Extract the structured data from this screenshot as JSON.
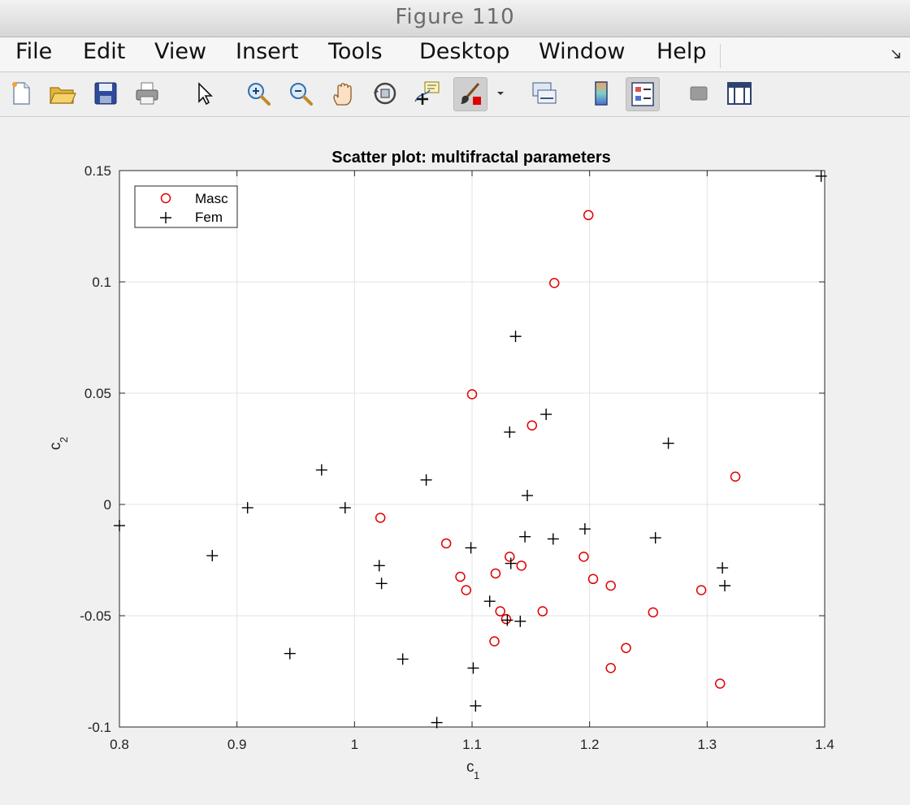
{
  "window": {
    "title": "Figure 110"
  },
  "menu": {
    "items": [
      "File",
      "Edit",
      "View",
      "Insert",
      "Tools",
      "Desktop",
      "Window",
      "Help"
    ]
  },
  "toolbar": {
    "buttons": [
      {
        "name": "new-figure-icon"
      },
      {
        "name": "open-file-icon"
      },
      {
        "name": "save-icon"
      },
      {
        "name": "print-icon"
      },
      {
        "name": "edit-plot-pointer-icon"
      },
      {
        "name": "zoom-in-icon"
      },
      {
        "name": "zoom-out-icon"
      },
      {
        "name": "pan-hand-icon"
      },
      {
        "name": "rotate-3d-icon"
      },
      {
        "name": "data-cursor-icon"
      },
      {
        "name": "brush-icon"
      },
      {
        "name": "brush-dropdown-icon"
      },
      {
        "name": "link-plot-icon"
      },
      {
        "name": "colorbar-icon"
      },
      {
        "name": "legend-icon"
      },
      {
        "name": "hide-plot-tools-icon"
      },
      {
        "name": "show-plot-tools-icon"
      }
    ]
  },
  "chart_data": {
    "type": "scatter",
    "title": "Scatter plot: multifractal parameters",
    "xlabel": "c",
    "xlabel_sub": "1",
    "ylabel": "c",
    "ylabel_sub": "2",
    "xlim": [
      0.8,
      1.4
    ],
    "ylim": [
      -0.1,
      0.15
    ],
    "xticks": [
      "0.8",
      "0.9",
      "1",
      "1.1",
      "1.2",
      "1.3",
      "1.4"
    ],
    "yticks": [
      "-0.1",
      "-0.05",
      "0",
      "0.05",
      "0.1",
      "0.15"
    ],
    "grid": true,
    "legend_position": "top-left",
    "series": [
      {
        "name": "Masc",
        "marker": "circle",
        "color": "#e00000",
        "points": [
          [
            1.199,
            0.13
          ],
          [
            1.17,
            0.0995
          ],
          [
            1.1,
            0.0495
          ],
          [
            1.151,
            0.0355
          ],
          [
            1.324,
            0.0125
          ],
          [
            1.022,
            -0.006
          ],
          [
            1.078,
            -0.0175
          ],
          [
            1.132,
            -0.0235
          ],
          [
            1.142,
            -0.0275
          ],
          [
            1.195,
            -0.0235
          ],
          [
            1.12,
            -0.031
          ],
          [
            1.09,
            -0.0325
          ],
          [
            1.203,
            -0.0335
          ],
          [
            1.218,
            -0.0365
          ],
          [
            1.095,
            -0.0385
          ],
          [
            1.295,
            -0.0385
          ],
          [
            1.124,
            -0.048
          ],
          [
            1.16,
            -0.048
          ],
          [
            1.254,
            -0.0485
          ],
          [
            1.129,
            -0.0515
          ],
          [
            1.119,
            -0.0615
          ],
          [
            1.231,
            -0.0645
          ],
          [
            1.218,
            -0.0735
          ],
          [
            1.311,
            -0.0805
          ]
        ]
      },
      {
        "name": "Fem",
        "marker": "plus",
        "color": "#000000",
        "points": [
          [
            1.397,
            0.1475
          ],
          [
            1.137,
            0.0755
          ],
          [
            1.163,
            0.0405
          ],
          [
            1.132,
            0.0325
          ],
          [
            1.267,
            0.0275
          ],
          [
            0.972,
            0.0155
          ],
          [
            1.061,
            0.011
          ],
          [
            1.147,
            0.004
          ],
          [
            0.909,
            -0.0015
          ],
          [
            0.992,
            -0.0015
          ],
          [
            0.8,
            -0.0095
          ],
          [
            1.196,
            -0.011
          ],
          [
            1.145,
            -0.0145
          ],
          [
            1.169,
            -0.0155
          ],
          [
            1.256,
            -0.015
          ],
          [
            1.099,
            -0.0195
          ],
          [
            0.879,
            -0.023
          ],
          [
            1.133,
            -0.0265
          ],
          [
            1.021,
            -0.0275
          ],
          [
            1.313,
            -0.0285
          ],
          [
            1.023,
            -0.0355
          ],
          [
            1.315,
            -0.0365
          ],
          [
            1.115,
            -0.0435
          ],
          [
            1.13,
            -0.052
          ],
          [
            1.141,
            -0.0525
          ],
          [
            0.945,
            -0.067
          ],
          [
            1.041,
            -0.0695
          ],
          [
            1.101,
            -0.0735
          ],
          [
            1.103,
            -0.0905
          ],
          [
            1.07,
            -0.098
          ]
        ]
      }
    ]
  }
}
